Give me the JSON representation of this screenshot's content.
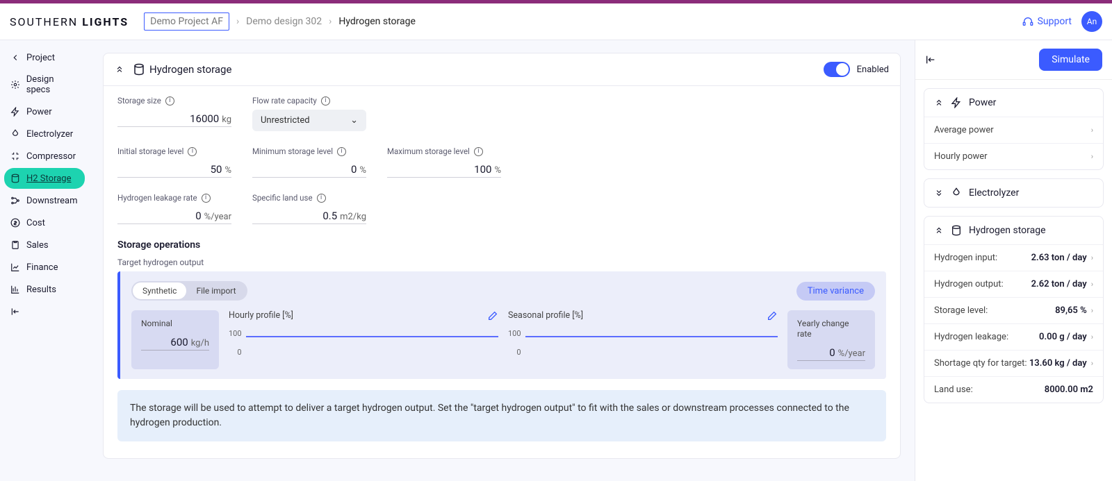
{
  "header": {
    "logo_a": "SOUTHERN",
    "logo_b": "LIGHTS",
    "breadcrumb": [
      "Demo Project AF",
      "Demo design 302",
      "Hydrogen storage"
    ],
    "support": "Support",
    "avatar": "An"
  },
  "sidebar": {
    "items": [
      {
        "label": "Project"
      },
      {
        "label": "Design specs"
      },
      {
        "label": "Power"
      },
      {
        "label": "Electrolyzer"
      },
      {
        "label": "Compressor"
      },
      {
        "label": "H2 Storage"
      },
      {
        "label": "Downstream"
      },
      {
        "label": "Cost"
      },
      {
        "label": "Sales"
      },
      {
        "label": "Finance"
      },
      {
        "label": "Results"
      }
    ]
  },
  "main": {
    "title": "Hydrogen storage",
    "enabled_label": "Enabled",
    "fields": {
      "storage_size": {
        "label": "Storage size",
        "value": "16000",
        "unit": "kg"
      },
      "flow_rate": {
        "label": "Flow rate capacity",
        "value": "Unrestricted"
      },
      "initial_level": {
        "label": "Initial storage level",
        "value": "50",
        "unit": "%"
      },
      "min_level": {
        "label": "Minimum storage level",
        "value": "0",
        "unit": "%"
      },
      "max_level": {
        "label": "Maximum storage level",
        "value": "100",
        "unit": "%"
      },
      "leakage": {
        "label": "Hydrogen leakage rate",
        "value": "0",
        "unit": "%/year"
      },
      "land_use": {
        "label": "Specific land use",
        "value": "0.5",
        "unit": "m2/kg"
      }
    },
    "ops": {
      "section": "Storage operations",
      "target_label": "Target hydrogen output",
      "tabs": [
        "Synthetic",
        "File import"
      ],
      "time_variance": "Time variance",
      "nominal": {
        "label": "Nominal",
        "value": "600",
        "unit": "kg/h"
      },
      "hourly": {
        "label": "Hourly profile [%]"
      },
      "seasonal": {
        "label": "Seasonal profile [%]"
      },
      "yearly": {
        "label": "Yearly change rate",
        "value": "0",
        "unit": "%/year"
      },
      "y_hi": "100",
      "y_lo": "0",
      "note": "The storage will be used to attempt to deliver a target hydrogen output. Set the \"target hydrogen output\" to fit with the sales or downstream processes connected to the hydrogen production."
    }
  },
  "right": {
    "simulate": "Simulate",
    "power": {
      "title": "Power",
      "rows": [
        {
          "k": "Average power"
        },
        {
          "k": "Hourly power"
        }
      ]
    },
    "electrolyzer": {
      "title": "Electrolyzer"
    },
    "hstorage": {
      "title": "Hydrogen storage",
      "rows": [
        {
          "k": "Hydrogen input:",
          "v": "2.63 ton / day"
        },
        {
          "k": "Hydrogen output:",
          "v": "2.62 ton / day"
        },
        {
          "k": "Storage level:",
          "v": "89,65 %"
        },
        {
          "k": "Hydrogen leakage:",
          "v": "0.00 g / day"
        },
        {
          "k": "Shortage qty for target:",
          "v": "13.60 kg / day"
        },
        {
          "k": "Land use:",
          "v": "8000.00 m2"
        }
      ]
    }
  },
  "chart_data": [
    {
      "type": "line",
      "title": "Hourly profile [%]",
      "x": [
        0,
        24
      ],
      "values": [
        100,
        100
      ],
      "ylim": [
        0,
        100
      ],
      "ylabel": "%"
    },
    {
      "type": "line",
      "title": "Seasonal profile [%]",
      "x": [
        0,
        12
      ],
      "values": [
        100,
        100
      ],
      "ylim": [
        0,
        100
      ],
      "ylabel": "%"
    }
  ]
}
